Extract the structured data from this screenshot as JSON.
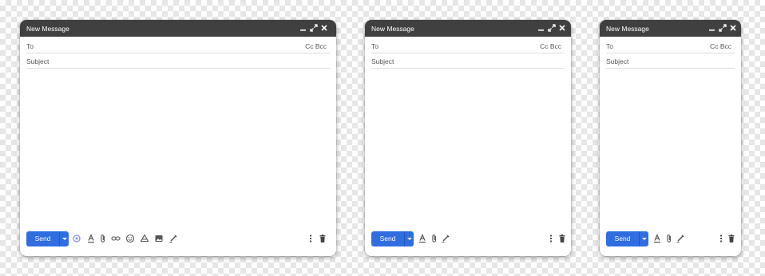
{
  "compose_windows": [
    {
      "title": "New Message",
      "to_label": "To",
      "cc_bcc_label": "Cc Bcc",
      "subject_placeholder": "Subject",
      "send_label": "Send",
      "toolbar_icons": [
        "ai-sparkle-icon",
        "format-text-icon",
        "attach-icon",
        "link-icon",
        "emoji-icon",
        "drive-icon",
        "photo-icon",
        "signature-icon"
      ]
    },
    {
      "title": "New Message",
      "to_label": "To",
      "cc_bcc_label": "Cc Bcc",
      "subject_placeholder": "Subject",
      "send_label": "Send",
      "toolbar_icons": [
        "format-text-icon",
        "attach-icon",
        "signature-icon"
      ]
    },
    {
      "title": "New Message",
      "to_label": "To",
      "cc_bcc_label": "Cc Bcc",
      "subject_placeholder": "Subject",
      "send_label": "Send",
      "toolbar_icons": [
        "format-text-icon",
        "attach-icon",
        "signature-icon"
      ]
    }
  ],
  "colors": {
    "titlebar": "#404040",
    "send_button": "#2f6de1",
    "ai_sparkle": "#8a8cf0",
    "icon": "#555555"
  }
}
